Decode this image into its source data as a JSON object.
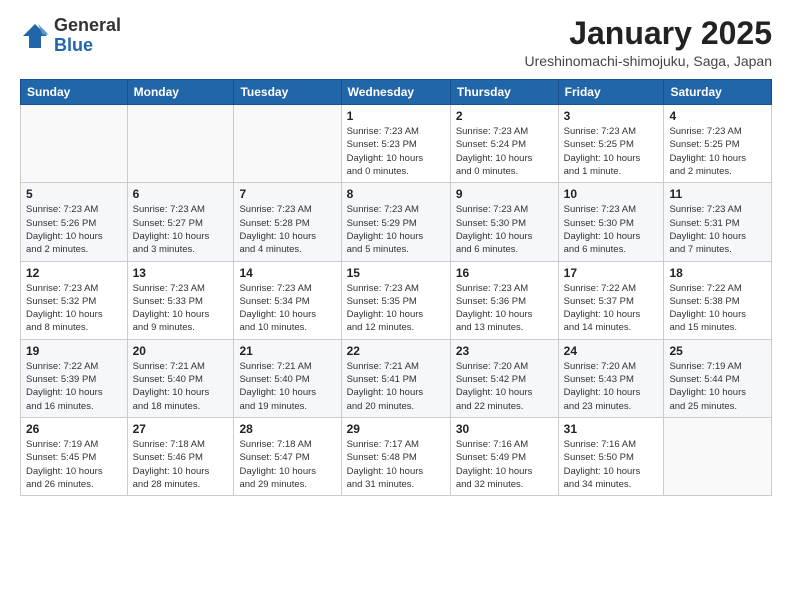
{
  "header": {
    "logo_general": "General",
    "logo_blue": "Blue",
    "month_title": "January 2025",
    "location": "Ureshinomachi-shimojuku, Saga, Japan"
  },
  "weekdays": [
    "Sunday",
    "Monday",
    "Tuesday",
    "Wednesday",
    "Thursday",
    "Friday",
    "Saturday"
  ],
  "weeks": [
    [
      {
        "day": "",
        "info": ""
      },
      {
        "day": "",
        "info": ""
      },
      {
        "day": "",
        "info": ""
      },
      {
        "day": "1",
        "info": "Sunrise: 7:23 AM\nSunset: 5:23 PM\nDaylight: 10 hours\nand 0 minutes."
      },
      {
        "day": "2",
        "info": "Sunrise: 7:23 AM\nSunset: 5:24 PM\nDaylight: 10 hours\nand 0 minutes."
      },
      {
        "day": "3",
        "info": "Sunrise: 7:23 AM\nSunset: 5:25 PM\nDaylight: 10 hours\nand 1 minute."
      },
      {
        "day": "4",
        "info": "Sunrise: 7:23 AM\nSunset: 5:25 PM\nDaylight: 10 hours\nand 2 minutes."
      }
    ],
    [
      {
        "day": "5",
        "info": "Sunrise: 7:23 AM\nSunset: 5:26 PM\nDaylight: 10 hours\nand 2 minutes."
      },
      {
        "day": "6",
        "info": "Sunrise: 7:23 AM\nSunset: 5:27 PM\nDaylight: 10 hours\nand 3 minutes."
      },
      {
        "day": "7",
        "info": "Sunrise: 7:23 AM\nSunset: 5:28 PM\nDaylight: 10 hours\nand 4 minutes."
      },
      {
        "day": "8",
        "info": "Sunrise: 7:23 AM\nSunset: 5:29 PM\nDaylight: 10 hours\nand 5 minutes."
      },
      {
        "day": "9",
        "info": "Sunrise: 7:23 AM\nSunset: 5:30 PM\nDaylight: 10 hours\nand 6 minutes."
      },
      {
        "day": "10",
        "info": "Sunrise: 7:23 AM\nSunset: 5:30 PM\nDaylight: 10 hours\nand 6 minutes."
      },
      {
        "day": "11",
        "info": "Sunrise: 7:23 AM\nSunset: 5:31 PM\nDaylight: 10 hours\nand 7 minutes."
      }
    ],
    [
      {
        "day": "12",
        "info": "Sunrise: 7:23 AM\nSunset: 5:32 PM\nDaylight: 10 hours\nand 8 minutes."
      },
      {
        "day": "13",
        "info": "Sunrise: 7:23 AM\nSunset: 5:33 PM\nDaylight: 10 hours\nand 9 minutes."
      },
      {
        "day": "14",
        "info": "Sunrise: 7:23 AM\nSunset: 5:34 PM\nDaylight: 10 hours\nand 10 minutes."
      },
      {
        "day": "15",
        "info": "Sunrise: 7:23 AM\nSunset: 5:35 PM\nDaylight: 10 hours\nand 12 minutes."
      },
      {
        "day": "16",
        "info": "Sunrise: 7:23 AM\nSunset: 5:36 PM\nDaylight: 10 hours\nand 13 minutes."
      },
      {
        "day": "17",
        "info": "Sunrise: 7:22 AM\nSunset: 5:37 PM\nDaylight: 10 hours\nand 14 minutes."
      },
      {
        "day": "18",
        "info": "Sunrise: 7:22 AM\nSunset: 5:38 PM\nDaylight: 10 hours\nand 15 minutes."
      }
    ],
    [
      {
        "day": "19",
        "info": "Sunrise: 7:22 AM\nSunset: 5:39 PM\nDaylight: 10 hours\nand 16 minutes."
      },
      {
        "day": "20",
        "info": "Sunrise: 7:21 AM\nSunset: 5:40 PM\nDaylight: 10 hours\nand 18 minutes."
      },
      {
        "day": "21",
        "info": "Sunrise: 7:21 AM\nSunset: 5:40 PM\nDaylight: 10 hours\nand 19 minutes."
      },
      {
        "day": "22",
        "info": "Sunrise: 7:21 AM\nSunset: 5:41 PM\nDaylight: 10 hours\nand 20 minutes."
      },
      {
        "day": "23",
        "info": "Sunrise: 7:20 AM\nSunset: 5:42 PM\nDaylight: 10 hours\nand 22 minutes."
      },
      {
        "day": "24",
        "info": "Sunrise: 7:20 AM\nSunset: 5:43 PM\nDaylight: 10 hours\nand 23 minutes."
      },
      {
        "day": "25",
        "info": "Sunrise: 7:19 AM\nSunset: 5:44 PM\nDaylight: 10 hours\nand 25 minutes."
      }
    ],
    [
      {
        "day": "26",
        "info": "Sunrise: 7:19 AM\nSunset: 5:45 PM\nDaylight: 10 hours\nand 26 minutes."
      },
      {
        "day": "27",
        "info": "Sunrise: 7:18 AM\nSunset: 5:46 PM\nDaylight: 10 hours\nand 28 minutes."
      },
      {
        "day": "28",
        "info": "Sunrise: 7:18 AM\nSunset: 5:47 PM\nDaylight: 10 hours\nand 29 minutes."
      },
      {
        "day": "29",
        "info": "Sunrise: 7:17 AM\nSunset: 5:48 PM\nDaylight: 10 hours\nand 31 minutes."
      },
      {
        "day": "30",
        "info": "Sunrise: 7:16 AM\nSunset: 5:49 PM\nDaylight: 10 hours\nand 32 minutes."
      },
      {
        "day": "31",
        "info": "Sunrise: 7:16 AM\nSunset: 5:50 PM\nDaylight: 10 hours\nand 34 minutes."
      },
      {
        "day": "",
        "info": ""
      }
    ]
  ]
}
